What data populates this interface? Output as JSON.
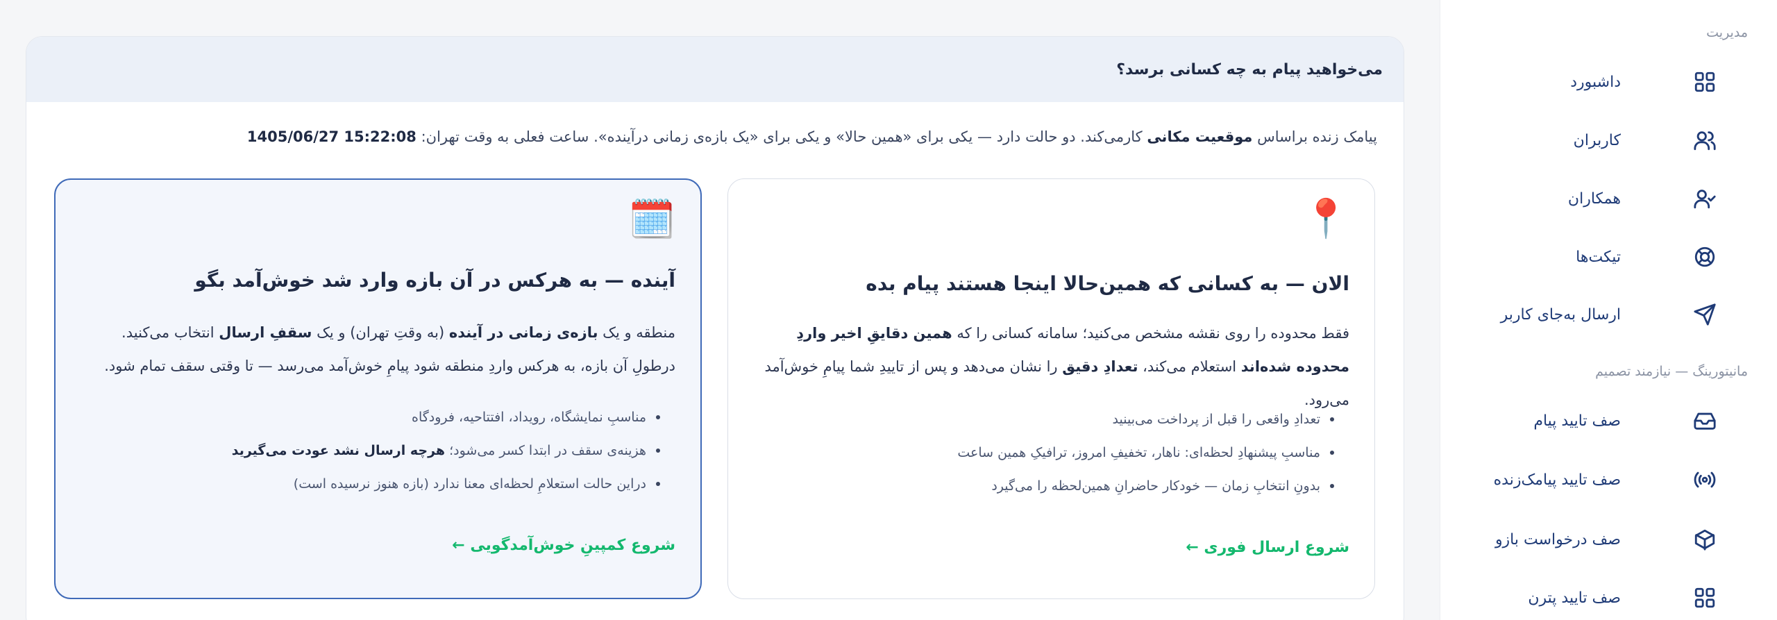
{
  "sidebar": {
    "section_management": "مدیریت",
    "section_monitoring": "مانیتورینگ — نیازمند تصمیم",
    "items": [
      {
        "label": "داشبورد",
        "icon": "grid-icon"
      },
      {
        "label": "کاربران",
        "icon": "users-icon"
      },
      {
        "label": "همکاران",
        "icon": "user-check-icon"
      },
      {
        "label": "تیکت‌ها",
        "icon": "lifebuoy-icon"
      },
      {
        "label": "ارسال به‌جای کاربر",
        "icon": "send-icon"
      },
      {
        "label": "صف تایید پیام",
        "icon": "inbox-icon"
      },
      {
        "label": "صف تایید پیامک‌زنده",
        "icon": "broadcast-icon"
      },
      {
        "label": "صف درخواست بازو",
        "icon": "package-icon"
      },
      {
        "label": "صف تایید پترن",
        "icon": "grid-icon"
      }
    ]
  },
  "main": {
    "header_title": "می‌خواهید پیام به چه کسانی برسد؟",
    "intro": {
      "part1": "پیامک زنده براساس ",
      "bold1": "موقعیت مکانی",
      "part2": " کار‌می‌کند. دو حالت دارد — یکی برای «همین حالا» و یکی برای «یک بازه‌ی زمانی درآینده». ساعت فعلی به وقت تهران: ",
      "datetime": "1405/06/27 15:22:08"
    },
    "now_option": {
      "emoji": "📍",
      "title": "الان — به کسانی که همین‌حالا اینجا هستند پیام بده",
      "desc_part1": "فقط محدوده را روی نقشه مشخص می‌کنید؛ سامانه کسانی را که ",
      "desc_bold1": "همین دقایقِ اخیر واردِ محدوده شده‌اند",
      "desc_part2": " استعلام می‌کند، ",
      "desc_bold2": "تعدادِ دقیق",
      "desc_part3": " را نشان می‌دهد و پس از تاییدِ شما پیامِ خوش‌آمد می‌رود.",
      "bullets": [
        "تعدادِ واقعی را قبل از پرداخت می‌بینید",
        "مناسبِ پیشنهادِ لحظه‌ای: ناهار، تخفیفِ امروز، ترافیکِ همین ساعت",
        "بدونِ انتخابِ زمان — خودکار حاضرانِ همین‌لحظه را می‌گیرد"
      ],
      "cta": "شروع ارسال فوری ←"
    },
    "future_option": {
      "emoji": "🗓️",
      "title": "آینده — به هرکس در آن بازه وارد شد خوش‌آمد بگو",
      "desc_part1": "منطقه و یک ",
      "desc_bold1": "بازه‌ی زمانی در آینده",
      "desc_part2": " (به وقتِ تهران) و یک ",
      "desc_bold2": "سقفِ ارسال",
      "desc_part3": " انتخاب می‌کنید. درطولِ آن بازه، به هرکس واردِ منطقه شود پیامِ خوش‌آمد می‌رسد — تا وقتی سقف تمام شود.",
      "bullets": [
        {
          "text": "مناسبِ نمایشگاه، رویداد، افتتاحیه، فرودگاه",
          "bold": ""
        },
        {
          "text": "هزینه‌ی سقف در ابتدا کسر می‌شود؛ ",
          "bold": "هرچه ارسال نشد عودت می‌گیرید"
        },
        {
          "text": "دراین حالت استعلامِ لحظه‌ای معنا ندارد (بازه هنوز نرسیده است)",
          "bold": ""
        }
      ],
      "cta": "شروع کمپینِ خوش‌آمدگویی ←"
    }
  }
}
